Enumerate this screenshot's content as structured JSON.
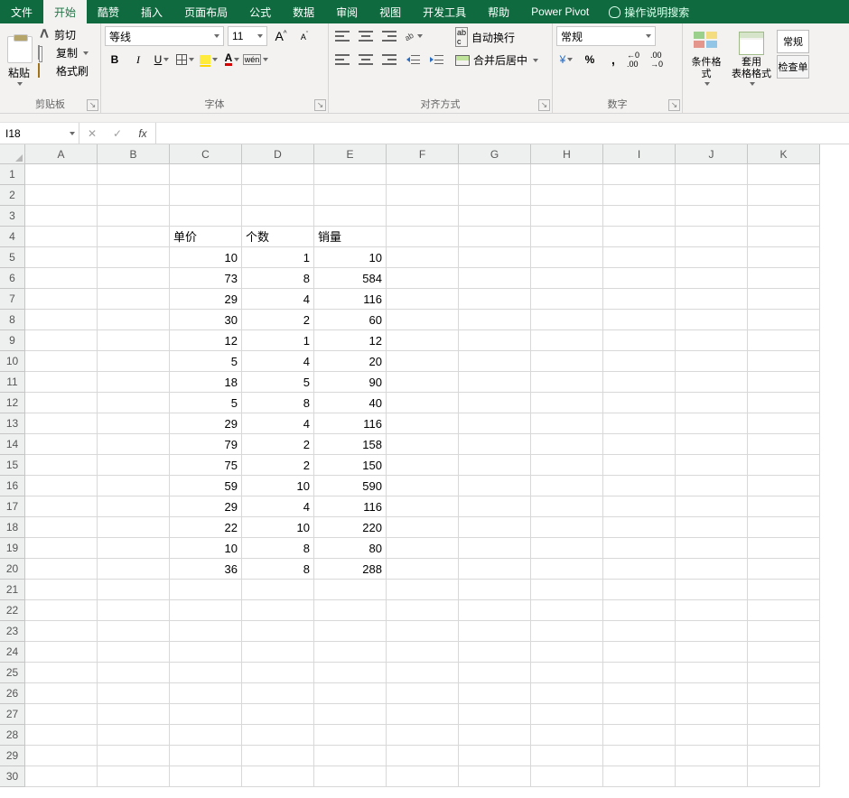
{
  "tabs": {
    "file": "文件",
    "home": "开始",
    "kuzan": "酷赞",
    "insert": "插入",
    "layout": "页面布局",
    "formulas": "公式",
    "data": "数据",
    "review": "审阅",
    "view": "视图",
    "dev": "开发工具",
    "help": "帮助",
    "powerpivot": "Power Pivot",
    "tellme": "操作说明搜索"
  },
  "ribbon": {
    "clipboard": {
      "paste": "粘贴",
      "cut": "剪切",
      "copy": "复制",
      "painter": "格式刷",
      "group": "剪贴板"
    },
    "font": {
      "name": "等线",
      "size": "11",
      "wen": "wén",
      "group": "字体",
      "bold": "B",
      "italic": "I",
      "underline": "U",
      "fontcolor_letter": "A"
    },
    "align": {
      "wraptext": "自动换行",
      "merge": "合并后居中",
      "group": "对齐方式",
      "ab": "ab",
      "c": "c"
    },
    "number": {
      "format": "常规",
      "group": "数字",
      "dec_inc": "←0\n.00",
      "dec_dec": ".00\n→0"
    },
    "styles": {
      "cond": "条件格式",
      "fat": "套用\n表格格式",
      "normal": "常规",
      "check": "检查单",
      "group": ""
    }
  },
  "namebox": "I18",
  "formula": "",
  "columns": [
    "A",
    "B",
    "C",
    "D",
    "E",
    "F",
    "G",
    "H",
    "I",
    "J",
    "K"
  ],
  "rows": [
    "1",
    "2",
    "3",
    "4",
    "5",
    "6",
    "7",
    "8",
    "9",
    "10",
    "11",
    "12",
    "13",
    "14",
    "15",
    "16",
    "17",
    "18",
    "19",
    "20",
    "21",
    "22",
    "23",
    "24",
    "25",
    "26",
    "27",
    "28",
    "29",
    "30"
  ],
  "sheet_data": {
    "headers": {
      "C4": "单价",
      "D4": "个数",
      "E4": "销量"
    },
    "body": [
      {
        "C": 10,
        "D": 1,
        "E": 10
      },
      {
        "C": 73,
        "D": 8,
        "E": 584
      },
      {
        "C": 29,
        "D": 4,
        "E": 116
      },
      {
        "C": 30,
        "D": 2,
        "E": 60
      },
      {
        "C": 12,
        "D": 1,
        "E": 12
      },
      {
        "C": 5,
        "D": 4,
        "E": 20
      },
      {
        "C": 18,
        "D": 5,
        "E": 90
      },
      {
        "C": 5,
        "D": 8,
        "E": 40
      },
      {
        "C": 29,
        "D": 4,
        "E": 116
      },
      {
        "C": 79,
        "D": 2,
        "E": 158
      },
      {
        "C": 75,
        "D": 2,
        "E": 150
      },
      {
        "C": 59,
        "D": 10,
        "E": 590
      },
      {
        "C": 29,
        "D": 4,
        "E": 116
      },
      {
        "C": 22,
        "D": 10,
        "E": 220
      },
      {
        "C": 10,
        "D": 8,
        "E": 80
      },
      {
        "C": 36,
        "D": 8,
        "E": 288
      }
    ]
  }
}
